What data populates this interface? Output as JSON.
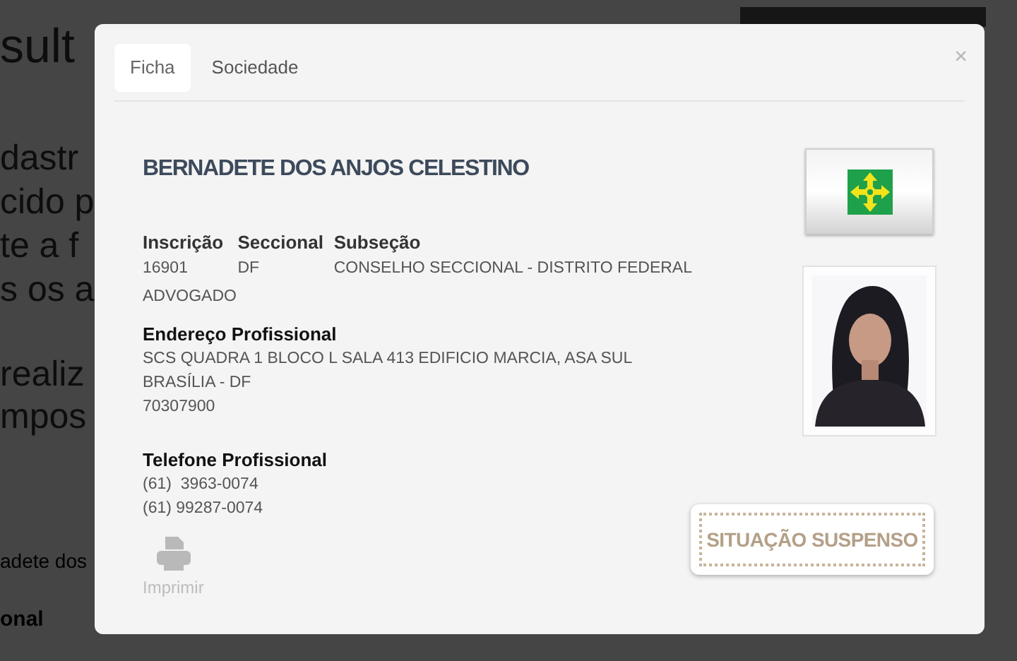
{
  "background": {
    "heading": "sult",
    "lines": [
      "dastr",
      "cido p",
      "te a f",
      "s os a"
    ],
    "lines_2": [
      "realiz",
      "mpos"
    ],
    "result_name": "adete dos",
    "column_label": "onal"
  },
  "modal": {
    "tabs": [
      {
        "label": "Ficha",
        "selected": true
      },
      {
        "label": "Sociedade",
        "selected": false
      }
    ],
    "close": "×",
    "name": "BERNADETE DOS ANJOS CELESTINO",
    "fields": [
      {
        "label": "Inscrição",
        "value": "16901"
      },
      {
        "label": "Seccional",
        "value": "DF"
      },
      {
        "label": "Subseção",
        "value": "CONSELHO SECCIONAL - DISTRITO FEDERAL"
      }
    ],
    "category": "ADVOGADO",
    "address": {
      "label": "Endereço Profissional",
      "lines": [
        "SCS QUADRA 1 BLOCO L SALA 413 EDIFICIO MARCIA, ASA SUL",
        "BRASÍLIA - DF",
        "70307900"
      ]
    },
    "phone": {
      "label": "Telefone Profissional",
      "lines": [
        "(61)  3963-0074",
        "(61) 99287-0074"
      ]
    },
    "print": {
      "label": "Imprimir",
      "disabled": true
    },
    "status": "SITUAÇÃO SUSPENSO"
  }
}
